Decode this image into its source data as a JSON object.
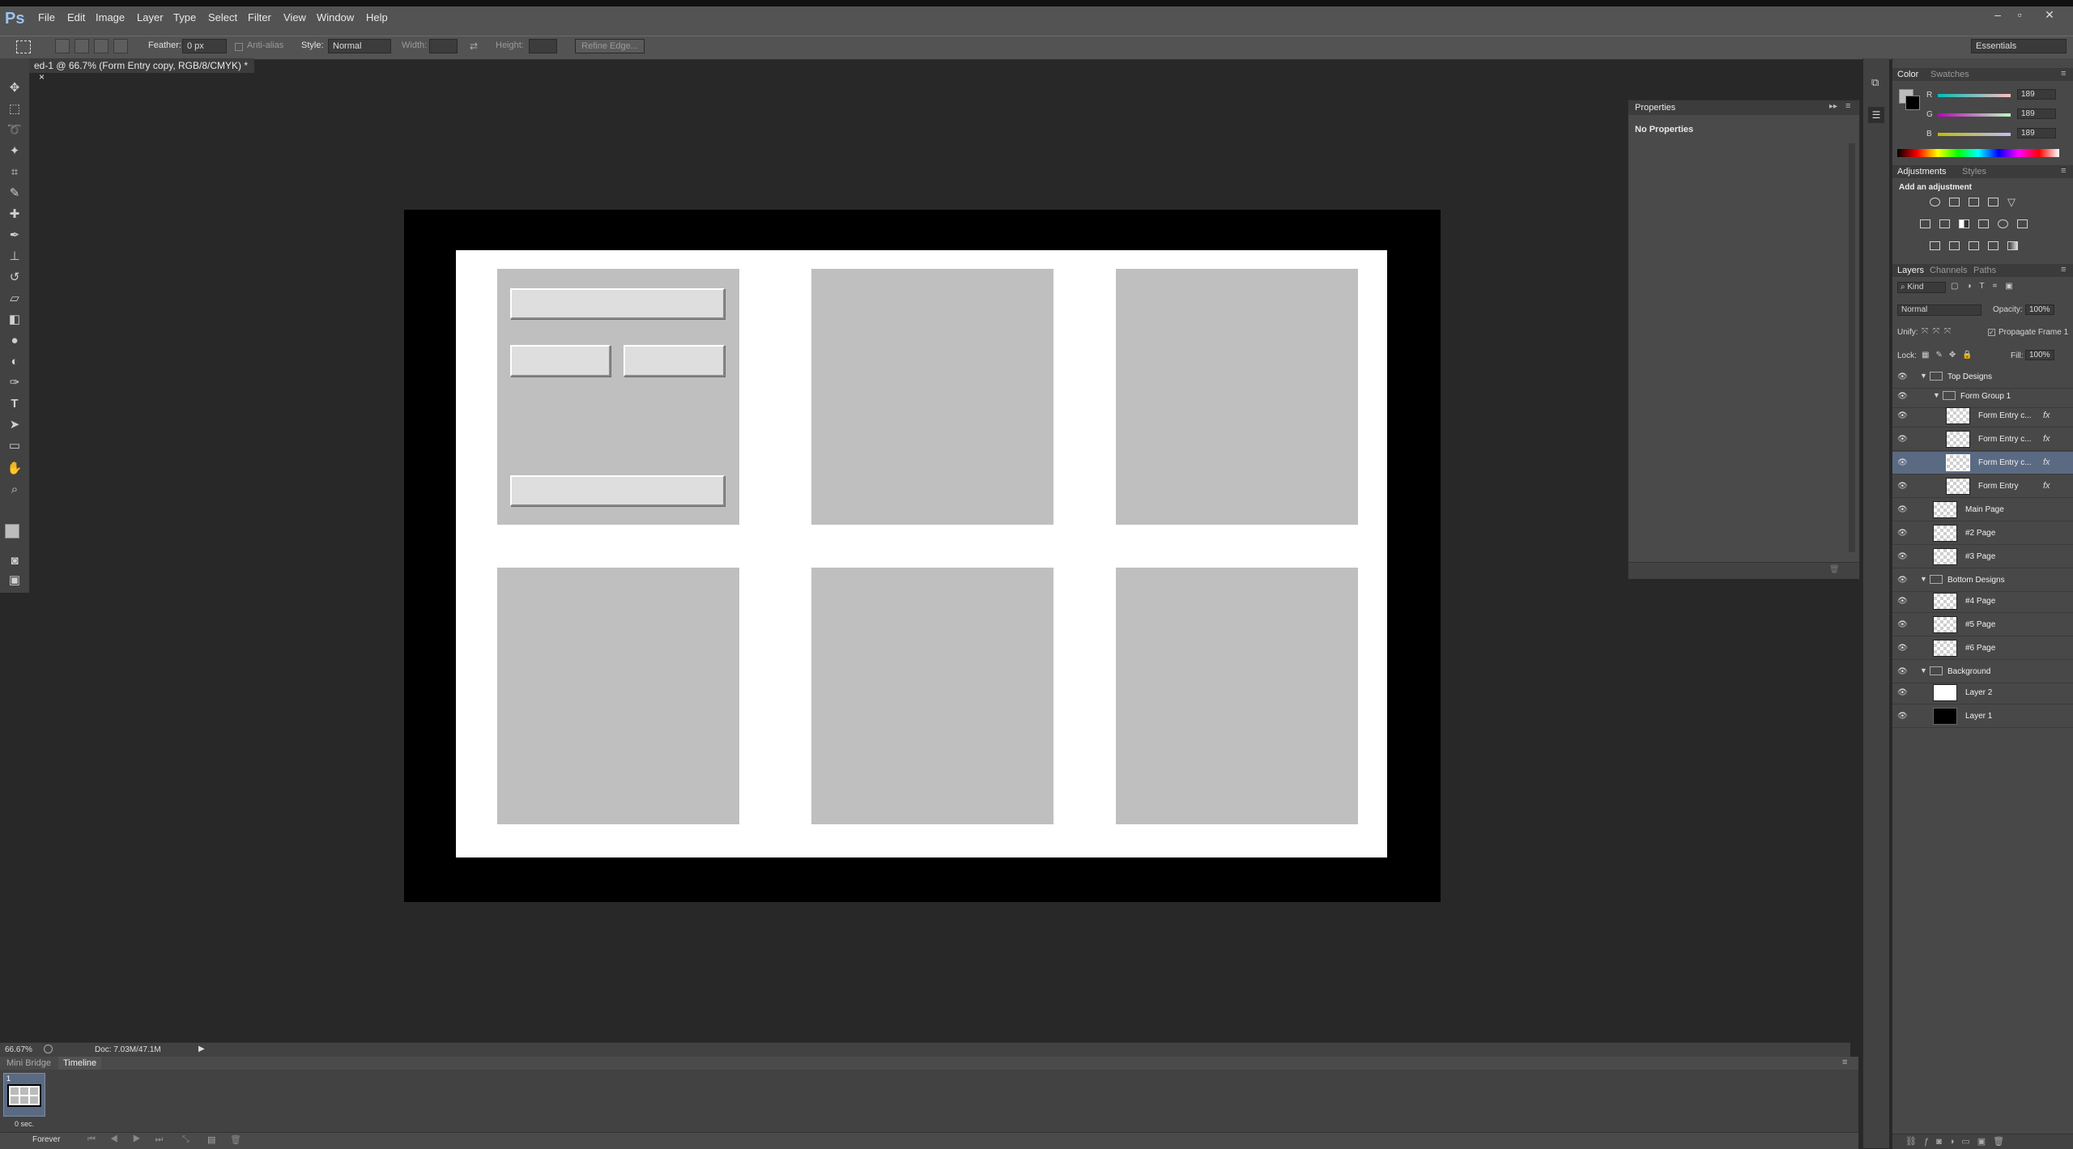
{
  "menubar": {
    "logo": "Ps",
    "items": [
      "File",
      "Edit",
      "Image",
      "Layer",
      "Type",
      "Select",
      "Filter",
      "View",
      "Window",
      "Help"
    ],
    "window_controls": [
      "–",
      "▫",
      "✕"
    ]
  },
  "options": {
    "feather_label": "Feather:",
    "feather_value": "0 px",
    "antialias_label": "Anti-alias",
    "style_label": "Style:",
    "style_value": "Normal",
    "width_label": "Width:",
    "height_label": "Height:",
    "refine_edge": "Refine Edge...",
    "workspace": "Essentials"
  },
  "document": {
    "tab_title": "ed-1 @ 66.7% (Form Entry copy, RGB/8/CMYK) *",
    "tab_close": "×"
  },
  "status": {
    "zoom": "66.67%",
    "doc_info": "Doc: 7.03M/47.1M"
  },
  "timeline": {
    "tabs": [
      "Mini Bridge",
      "Timeline"
    ],
    "frame_number": "1",
    "frame_delay": "0 sec.",
    "loop": "Forever"
  },
  "properties": {
    "title": "Properties",
    "content": "No Properties"
  },
  "color_panel": {
    "tabs": [
      "Color",
      "Swatches"
    ],
    "channels": [
      {
        "label": "R",
        "value": "189"
      },
      {
        "label": "G",
        "value": "189"
      },
      {
        "label": "B",
        "value": "189"
      }
    ],
    "foreground": "#bdbdbd",
    "background": "#000000"
  },
  "adjustments_panel": {
    "tabs": [
      "Adjustments",
      "Styles"
    ],
    "heading": "Add an adjustment"
  },
  "layers_panel": {
    "tabs": [
      "Layers",
      "Channels",
      "Paths"
    ],
    "kind_label": "Kind",
    "blend_mode": "Normal",
    "opacity_label": "Opacity:",
    "opacity_value": "100%",
    "unify_label": "Unify:",
    "propagate_label": "Propagate Frame 1",
    "lock_label": "Lock:",
    "fill_label": "Fill:",
    "fill_value": "100%",
    "layers": [
      {
        "name": "Top Designs",
        "type": "group",
        "indent": 0
      },
      {
        "name": "Form Group 1",
        "type": "group",
        "indent": 1
      },
      {
        "name": "Form Entry c...",
        "type": "layer",
        "indent": 2,
        "fx": "fx"
      },
      {
        "name": "Form Entry c...",
        "type": "layer",
        "indent": 2,
        "fx": "fx"
      },
      {
        "name": "Form Entry c...",
        "type": "layer",
        "indent": 2,
        "fx": "fx",
        "selected": true
      },
      {
        "name": "Form Entry",
        "type": "layer",
        "indent": 2,
        "fx": "fx"
      },
      {
        "name": "Main Page",
        "type": "layer",
        "indent": 1
      },
      {
        "name": "#2 Page",
        "type": "layer",
        "indent": 1
      },
      {
        "name": "#3 Page",
        "type": "layer",
        "indent": 1
      },
      {
        "name": "Bottom Designs",
        "type": "group",
        "indent": 0
      },
      {
        "name": "#4 Page",
        "type": "layer",
        "indent": 1
      },
      {
        "name": "#5 Page",
        "type": "layer",
        "indent": 1
      },
      {
        "name": "#6 Page",
        "type": "layer",
        "indent": 1
      },
      {
        "name": "Background",
        "type": "group",
        "indent": 0
      },
      {
        "name": "Layer 2",
        "type": "layer",
        "indent": 1,
        "thumb": "#ffffff"
      },
      {
        "name": "Layer 1",
        "type": "layer",
        "indent": 1,
        "thumb": "#000000"
      }
    ]
  }
}
